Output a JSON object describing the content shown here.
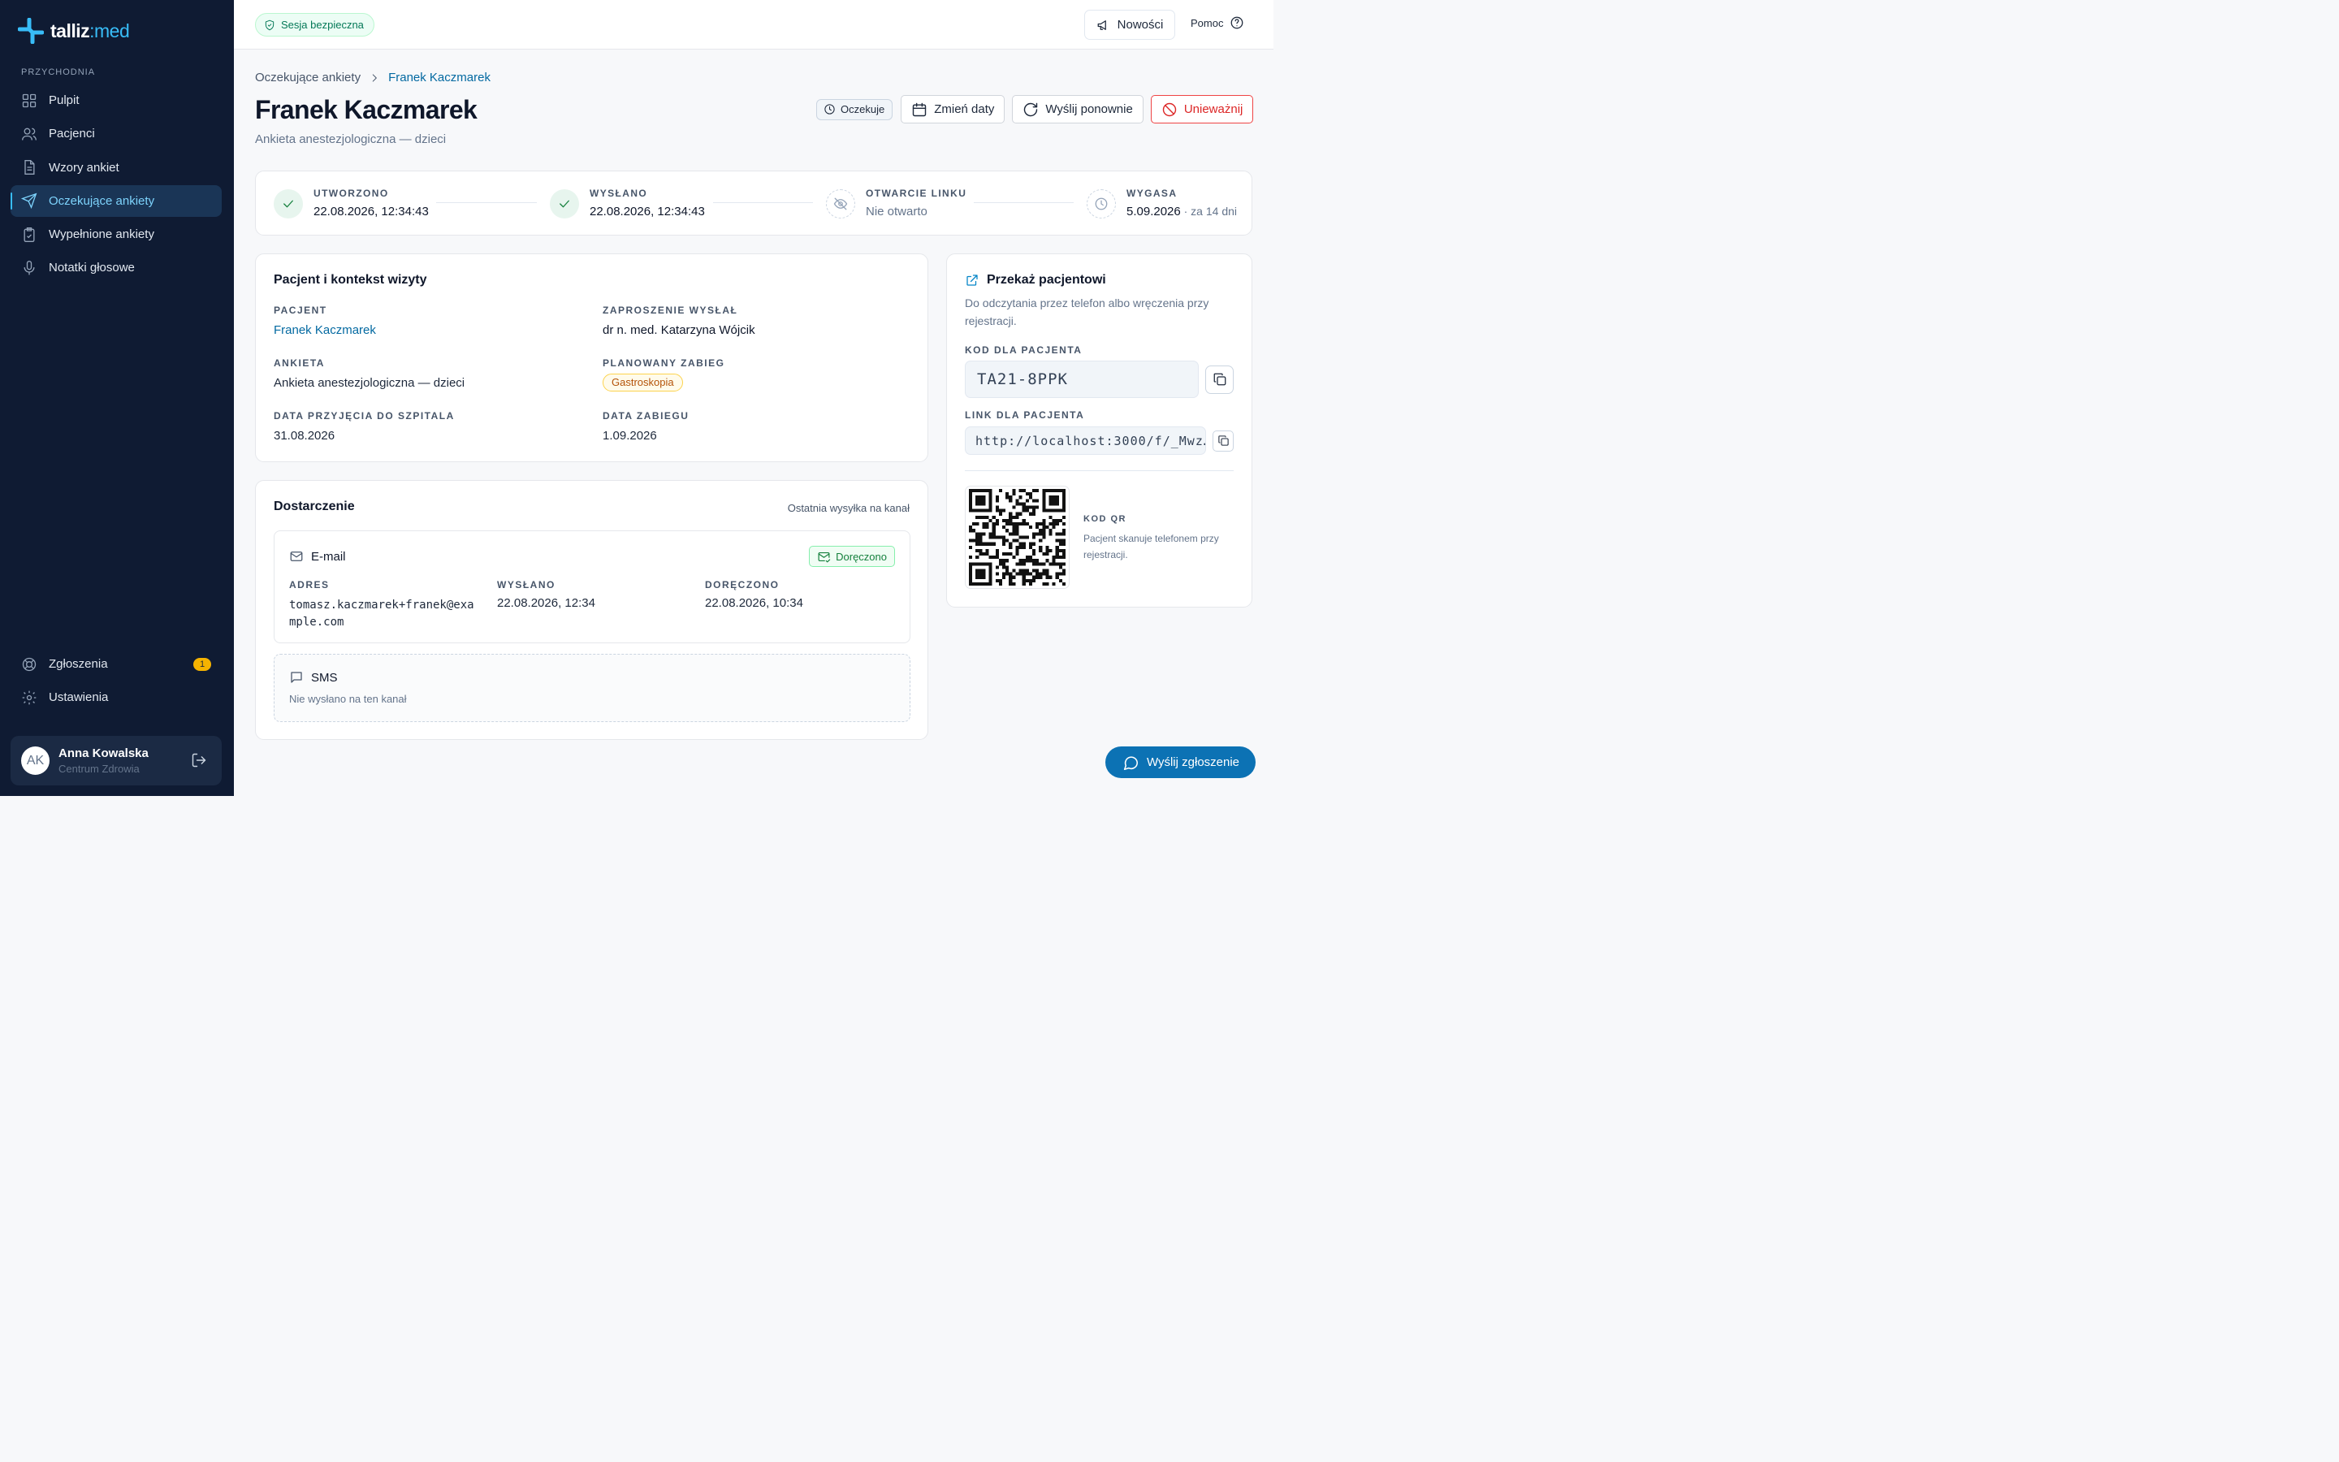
{
  "brand": {
    "name": "talliz",
    "sep": ":",
    "suffix": "med",
    "accent_color": "#38bdf8"
  },
  "sidebar": {
    "section": "PRZYCHODNIA",
    "items": [
      {
        "label": "Pulpit",
        "icon": "dashboard-icon"
      },
      {
        "label": "Pacjenci",
        "icon": "users-icon"
      },
      {
        "label": "Wzory ankiet",
        "icon": "document-icon"
      },
      {
        "label": "Oczekujące ankiety",
        "icon": "send-icon",
        "active": true
      },
      {
        "label": "Wypełnione ankiety",
        "icon": "clipboard-check-icon"
      },
      {
        "label": "Notatki głosowe",
        "icon": "microphone-icon"
      }
    ],
    "bottom_items": [
      {
        "label": "Zgłoszenia",
        "icon": "lifebuoy-icon",
        "badge": "1"
      },
      {
        "label": "Ustawienia",
        "icon": "gear-icon"
      }
    ],
    "user": {
      "initials": "AK",
      "name": "Anna Kowalska",
      "org": "Centrum Zdrowia"
    }
  },
  "topbar": {
    "secure_label": "Sesja bezpieczna",
    "news_label": "Nowości",
    "help_label": "Pomoc"
  },
  "breadcrumb": {
    "parent": "Oczekujące ankiety",
    "current": "Franek Kaczmarek"
  },
  "header": {
    "title": "Franek Kaczmarek",
    "subtitle": "Ankieta anestezjologiczna — dzieci",
    "status": "Oczekuje",
    "change_dates": "Zmień daty",
    "resend": "Wyślij ponownie",
    "invalidate": "Unieważnij"
  },
  "timeline": [
    {
      "label": "UTWORZONO",
      "value": "22.08.2026, 12:34:43",
      "state": "done"
    },
    {
      "label": "WYSŁANO",
      "value": "22.08.2026, 12:34:43",
      "state": "done"
    },
    {
      "label": "OTWARCIE LINKU",
      "value": "Nie otwarto",
      "state": "pending"
    },
    {
      "label": "WYGASA",
      "value": "5.09.2026",
      "extra": " · za 14 dni",
      "state": "pending"
    }
  ],
  "patient_card": {
    "title": "Pacjent i kontekst wizyty",
    "fields": {
      "patient_label": "PACJENT",
      "patient": "Franek Kaczmarek",
      "inviter_label": "ZAPROSZENIE WYSŁAŁ",
      "inviter": "dr n. med. Katarzyna Wójcik",
      "survey_label": "ANKIETA",
      "survey": "Ankieta anestezjologiczna — dzieci",
      "procedure_label": "PLANOWANY ZABIEG",
      "procedure": "Gastroskopia",
      "admission_label": "DATA PRZYJĘCIA DO SZPITALA",
      "admission": "31.08.2026",
      "procedure_date_label": "DATA ZABIEGU",
      "procedure_date": "1.09.2026"
    }
  },
  "delivery": {
    "title": "Dostarczenie",
    "note": "Ostatnia wysyłka na kanał",
    "email": {
      "title": "E-mail",
      "status": "Doręczono",
      "address_label": "ADRES",
      "address_line1": "tomasz.kaczmarek+franek@exa",
      "address_line2": "mple.com",
      "sent_label": "WYSŁANO",
      "sent": "22.08.2026, 12:34",
      "delivered_label": "DORĘCZONO",
      "delivered": "22.08.2026, 10:34"
    },
    "sms": {
      "title": "SMS",
      "status": "Nie wysłano na ten kanał"
    }
  },
  "handoff": {
    "title": "Przekaż pacjentowi",
    "description": "Do odczytania przez telefon albo wręczenia przy rejestracji.",
    "code_label": "KOD DLA PACJENTA",
    "code": "TA21-8PPK",
    "link_label": "LINK DLA PACJENTA",
    "link": "http://localhost:3000/f/_Mwz…",
    "qr_label": "KOD QR",
    "qr_description": "Pacjent skanuje telefonem przy rejestracji."
  },
  "fab": {
    "label": "Wyślij zgłoszenie"
  }
}
